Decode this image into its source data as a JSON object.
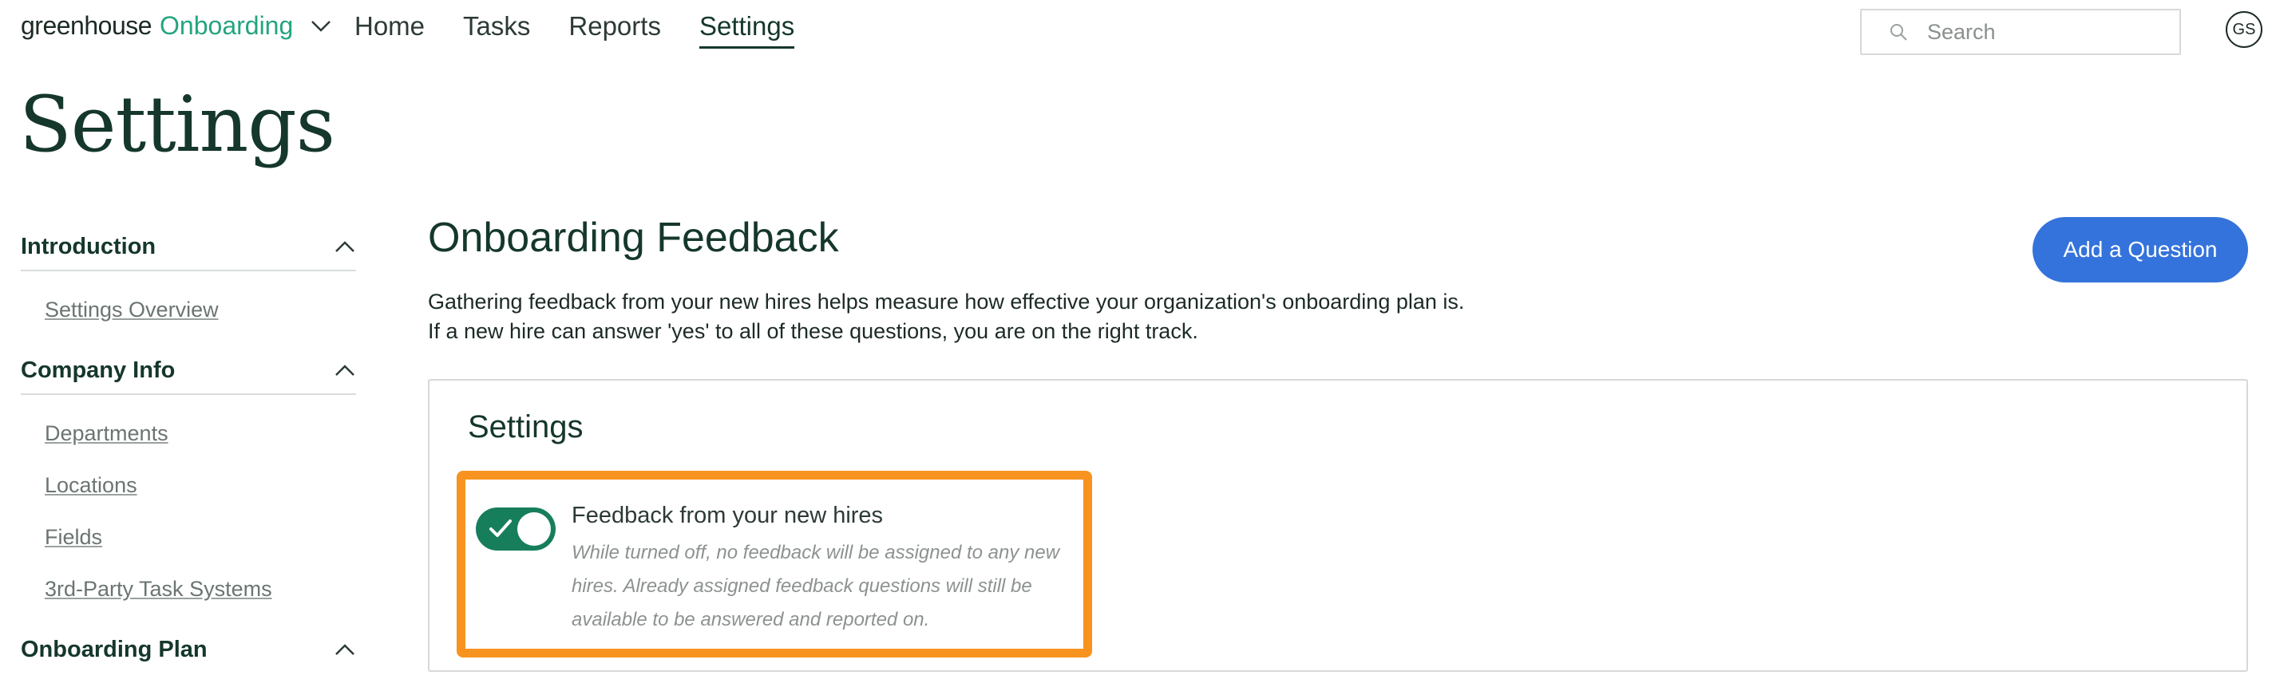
{
  "header": {
    "brand_name": "greenhouse",
    "brand_product": "Onboarding",
    "nav": [
      {
        "label": "Home",
        "active": false
      },
      {
        "label": "Tasks",
        "active": false
      },
      {
        "label": "Reports",
        "active": false
      },
      {
        "label": "Settings",
        "active": true
      }
    ],
    "search_placeholder": "Search",
    "avatar_initials": "GS"
  },
  "page": {
    "title": "Settings"
  },
  "sidebar": {
    "sections": [
      {
        "title": "Introduction",
        "expanded": true,
        "items": [
          "Settings Overview"
        ]
      },
      {
        "title": "Company Info",
        "expanded": true,
        "items": [
          "Departments",
          "Locations",
          "Fields",
          "3rd-Party Task Systems"
        ]
      },
      {
        "title": "Onboarding Plan",
        "expanded": true,
        "items": []
      }
    ]
  },
  "main": {
    "title": "Onboarding Feedback",
    "description_line1": "Gathering feedback from your new hires helps measure how effective your organization's onboarding plan is.",
    "description_line2": "If a new hire can answer 'yes' to all of these questions, you are on the right track.",
    "add_button": "Add a Question",
    "settings_panel": {
      "title": "Settings",
      "toggle_on": true,
      "feedback_label": "Feedback from your new hires",
      "feedback_help": "While turned off, no feedback will be assigned to any new hires. Already assigned feedback questions will still be available to be answered and reported on."
    }
  },
  "colors": {
    "brand_green": "#24a47f",
    "toggle_green": "#177e5c",
    "primary_blue": "#3473db",
    "highlight_orange": "#f7931e",
    "heading_dark_green": "#15372c"
  },
  "icons": [
    "chevron-down-icon",
    "search-icon",
    "chevron-up-icon",
    "checkmark-icon"
  ]
}
